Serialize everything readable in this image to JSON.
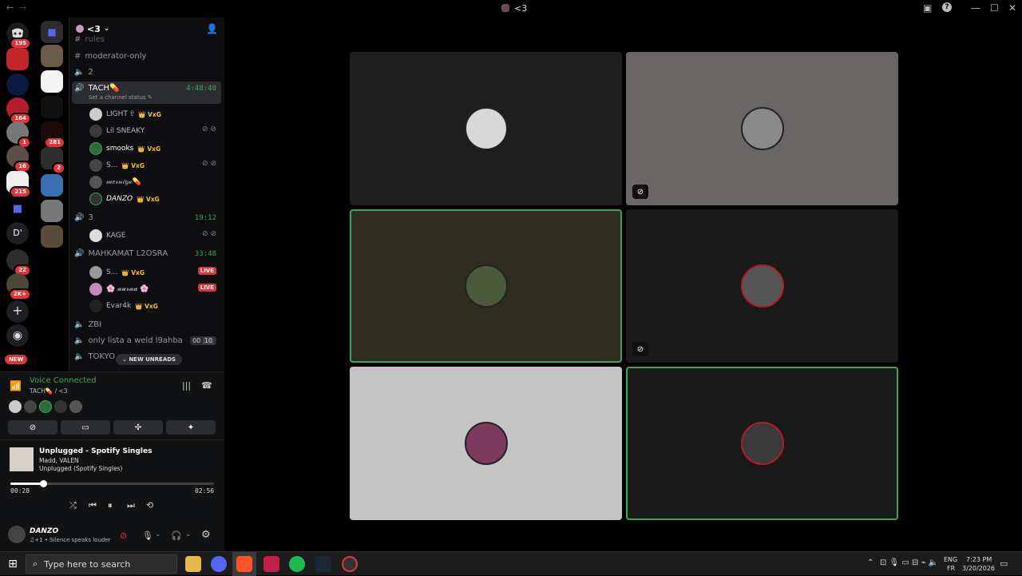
{
  "titlebar": {
    "back": "←",
    "forward": "→",
    "title": "<3",
    "inbox": "▣",
    "help": "?",
    "minimize": "—",
    "maximize": "☐",
    "close": "✕"
  },
  "rail": {
    "badges": [
      "195",
      "164",
      "1",
      "16",
      "215",
      "22",
      "2K+"
    ],
    "dm_letter": "D'",
    "new_label": "NEW"
  },
  "rail2": {
    "badges": [
      "281",
      "2"
    ]
  },
  "sidebar": {
    "server_name": "<3",
    "channels": [
      {
        "name": "rules",
        "type": "text"
      },
      {
        "name": "moderator-only",
        "type": "text"
      },
      {
        "name": "2",
        "type": "voice"
      },
      {
        "name": "TACH💊",
        "type": "voice-active",
        "status": "Set a channel status ✎",
        "timer": "4:48:40"
      },
      {
        "name": "3",
        "type": "voice-active",
        "timer": "19:12"
      },
      {
        "name": "MAHKAMAT L2OSRA",
        "type": "voice-active",
        "timer": "33:48"
      },
      {
        "name": "ZBI",
        "type": "voice"
      },
      {
        "name": "only lista a weld l9ahba",
        "type": "voice",
        "count_a": "00",
        "count_b": "10"
      },
      {
        "name": "TOKYO",
        "type": "voice"
      }
    ],
    "tach_users": [
      {
        "name": "LIGHT 𝔏",
        "tag": "👑 VxG",
        "muted": false
      },
      {
        "name": "Lil SNEAKY",
        "tag": "",
        "muted": true
      },
      {
        "name": "smooks",
        "tag": "👑 VxG",
        "muted": false
      },
      {
        "name": "S...",
        "tag": "👑 VxG",
        "muted": true
      },
      {
        "name": "𝓂𝑒𝓇𝓃𝒾𝑔𝒶💊",
        "tag": "",
        "muted": false
      },
      {
        "name": "DANZO",
        "tag": "👑 VxG",
        "muted": false
      }
    ],
    "room3_users": [
      {
        "name": "KAGE",
        "tag": "",
        "muted": true
      }
    ],
    "mahkamat_users": [
      {
        "name": "S...",
        "tag": "👑 VxG",
        "live": "LIVE"
      },
      {
        "name": "🌸 𝓪𝓾𝓻𝓪𝓪 🌸",
        "tag": "",
        "live": "LIVE"
      },
      {
        "name": "Evar4k",
        "tag": "👑 VxG",
        "live": ""
      }
    ],
    "new_unreads": "NEW UNREADS"
  },
  "voice": {
    "status": "Voice Connected",
    "channel": "TACH💊 / <3",
    "song_title": "Unplugged - Spotify Singles",
    "artist": "Madd, VALEN",
    "album": "Unplugged (Spotify Singles)",
    "elapsed": "00:28",
    "duration": "02:56",
    "progress": 0.16,
    "user_name": "DANZO",
    "user_status": "♫+1 • Silence speaks louder"
  },
  "grid": {
    "tiles": [
      {
        "bg": "#1e1e1e",
        "speaking": false,
        "muted_icon": false
      },
      {
        "bg": "#6a6666",
        "speaking": false,
        "muted_icon": true
      },
      {
        "bg": "#2e2d1f",
        "speaking": true,
        "muted_icon": false
      },
      {
        "bg": "#1a1a1a",
        "speaking": false,
        "muted_icon": true
      },
      {
        "bg": "#c4c4c4",
        "speaking": false,
        "muted_icon": false
      },
      {
        "bg": "#1a1a1a",
        "speaking": true,
        "muted_icon": false
      }
    ],
    "speaking_color": "#3ba55d"
  },
  "taskbar": {
    "search_placeholder": "Type here to search",
    "lang_top": "ENG",
    "lang_bottom": "FR",
    "time": "7:23 PM",
    "date": "3/20/2026"
  }
}
